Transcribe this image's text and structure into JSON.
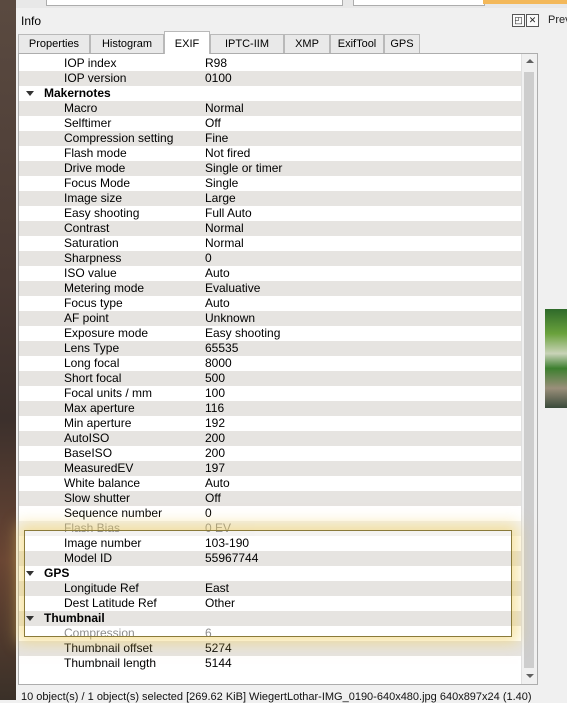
{
  "panel": {
    "title": "Info",
    "float_icon": "float-icon",
    "close_icon": "close-icon"
  },
  "preview_label": "Prev",
  "tabs": [
    {
      "label": "Properties"
    },
    {
      "label": "Histogram"
    },
    {
      "label": "EXIF",
      "active": true
    },
    {
      "label": "IPTC-IIM"
    },
    {
      "label": "XMP"
    },
    {
      "label": "ExifTool"
    },
    {
      "label": "GPS"
    }
  ],
  "rows": [
    {
      "type": "item",
      "key": "IOP index",
      "value": "R98"
    },
    {
      "type": "item",
      "key": "IOP version",
      "value": "0100"
    },
    {
      "type": "group",
      "key": "Makernotes"
    },
    {
      "type": "item",
      "key": "Macro",
      "value": "Normal"
    },
    {
      "type": "item",
      "key": "Selftimer",
      "value": "Off"
    },
    {
      "type": "item",
      "key": "Compression setting",
      "value": "Fine"
    },
    {
      "type": "item",
      "key": "Flash mode",
      "value": "Not fired"
    },
    {
      "type": "item",
      "key": "Drive mode",
      "value": "Single or timer"
    },
    {
      "type": "item",
      "key": "Focus Mode",
      "value": "Single"
    },
    {
      "type": "item",
      "key": "Image size",
      "value": "Large"
    },
    {
      "type": "item",
      "key": "Easy shooting",
      "value": "Full Auto"
    },
    {
      "type": "item",
      "key": "Contrast",
      "value": "Normal"
    },
    {
      "type": "item",
      "key": "Saturation",
      "value": "Normal"
    },
    {
      "type": "item",
      "key": "Sharpness",
      "value": "0"
    },
    {
      "type": "item",
      "key": "ISO value",
      "value": "Auto"
    },
    {
      "type": "item",
      "key": "Metering mode",
      "value": "Evaluative"
    },
    {
      "type": "item",
      "key": "Focus type",
      "value": "Auto"
    },
    {
      "type": "item",
      "key": "AF point",
      "value": "Unknown"
    },
    {
      "type": "item",
      "key": "Exposure mode",
      "value": "Easy shooting"
    },
    {
      "type": "item",
      "key": "Lens Type",
      "value": "65535"
    },
    {
      "type": "item",
      "key": "Long focal",
      "value": "8000"
    },
    {
      "type": "item",
      "key": "Short focal",
      "value": "500"
    },
    {
      "type": "item",
      "key": "Focal units / mm",
      "value": "100"
    },
    {
      "type": "item",
      "key": "Max aperture",
      "value": "116"
    },
    {
      "type": "item",
      "key": "Min aperture",
      "value": "192"
    },
    {
      "type": "item",
      "key": "AutoISO",
      "value": "200"
    },
    {
      "type": "item",
      "key": "BaseISO",
      "value": "200"
    },
    {
      "type": "item",
      "key": "MeasuredEV",
      "value": "197"
    },
    {
      "type": "item",
      "key": "White balance",
      "value": "Auto"
    },
    {
      "type": "item",
      "key": "Slow shutter",
      "value": "Off"
    },
    {
      "type": "item",
      "key": "Sequence number",
      "value": "0"
    },
    {
      "type": "item",
      "key": "Flash Bias",
      "value": "0 EV",
      "dim": true
    },
    {
      "type": "item",
      "key": "Image number",
      "value": "103-190"
    },
    {
      "type": "item",
      "key": "Model ID",
      "value": "55967744"
    },
    {
      "type": "group",
      "key": "GPS"
    },
    {
      "type": "item",
      "key": "Longitude Ref",
      "value": "East"
    },
    {
      "type": "item",
      "key": "Dest Latitude Ref",
      "value": "Other"
    },
    {
      "type": "group",
      "key": "Thumbnail"
    },
    {
      "type": "item",
      "key": "Compression",
      "value": "6",
      "dim": true
    },
    {
      "type": "item",
      "key": "Thumbnail offset",
      "value": "5274"
    },
    {
      "type": "item",
      "key": "Thumbnail length",
      "value": "5144"
    }
  ],
  "status_bar": "10 object(s) / 1 object(s) selected [269.62 KiB]  WiegertLothar-IMG_0190-640x480.jpg  640x897x24 (1.40)"
}
